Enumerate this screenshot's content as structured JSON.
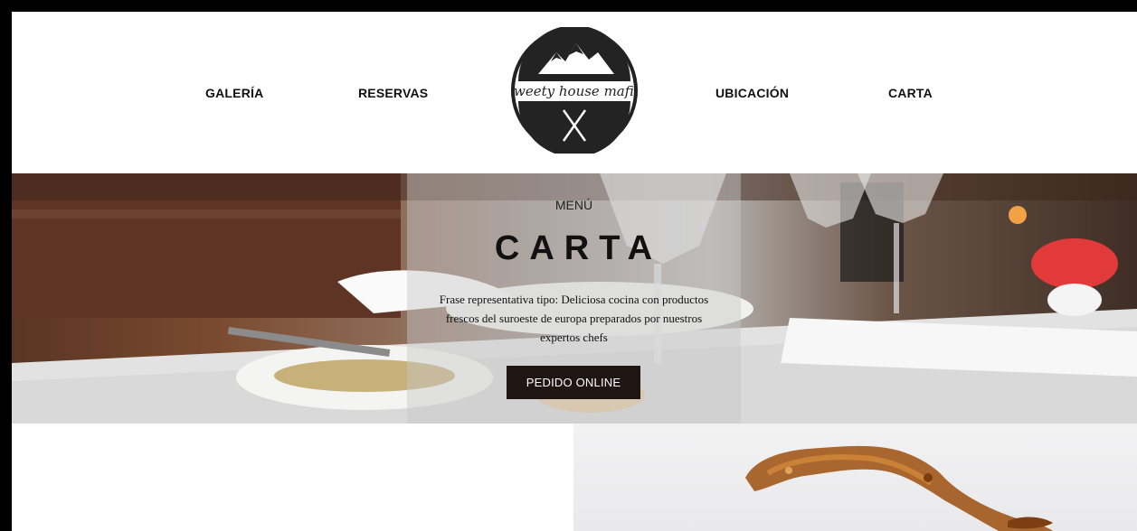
{
  "nav": {
    "items": [
      {
        "label": "GALERÍA"
      },
      {
        "label": "RESERVAS"
      },
      {
        "label": "UBICACIÓN"
      },
      {
        "label": "CARTA"
      }
    ],
    "logo_text": "sweety house mafia"
  },
  "hero": {
    "kicker": "MENÚ",
    "title": "CARTA",
    "description": "Frase representativa tipo: Deliciosa cocina con productos frescos del suroeste de europa preparados por nuestros expertos chefs",
    "button_label": "PEDIDO ONLINE"
  },
  "colors": {
    "button_bg": "#1f1512",
    "text": "#111111",
    "frame": "#000000"
  }
}
